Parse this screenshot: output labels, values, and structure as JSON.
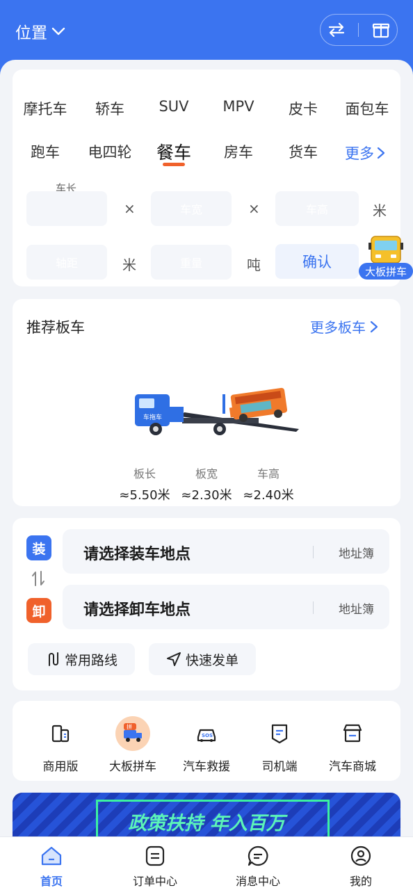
{
  "header": {
    "location": "位置"
  },
  "categories": {
    "row1": [
      "摩托车",
      "轿车",
      "SUV",
      "MPV",
      "皮卡",
      "面包车"
    ],
    "row2": [
      "跑车",
      "电四轮",
      "餐车",
      "房车",
      "货车"
    ],
    "active": "餐车",
    "more": "更多"
  },
  "dimensions": {
    "length_label": "车长",
    "width_placeholder": "车宽",
    "height_placeholder": "车高",
    "wheelbase_placeholder": "轴距",
    "weight_placeholder": "重量",
    "times": "×",
    "unit_m": "米",
    "unit_ton": "吨",
    "confirm": "确认"
  },
  "floating_badge": "大板拼车",
  "recommend": {
    "title": "推荐板车",
    "more": "更多板车",
    "truck_label": "车拖车",
    "specs": [
      {
        "label": "板长",
        "value": "≈5.50米"
      },
      {
        "label": "板宽",
        "value": "≈2.30米"
      },
      {
        "label": "车高",
        "value": "≈2.40米"
      }
    ]
  },
  "address": {
    "load_tag": "装",
    "unload_tag": "卸",
    "load_text": "请选择装车地点",
    "unload_text": "请选择卸车地点",
    "book": "地址簿",
    "routes": "常用路线",
    "quick": "快速发单"
  },
  "services": [
    {
      "name": "商用版",
      "icon": "building-icon"
    },
    {
      "name": "大板拼车",
      "icon": "carpool-truck-icon",
      "badge": "拼"
    },
    {
      "name": "汽车救援",
      "icon": "sos-car-icon",
      "sos": "SOS"
    },
    {
      "name": "司机端",
      "icon": "driver-icon"
    },
    {
      "name": "汽车商城",
      "icon": "store-icon"
    }
  ],
  "banner": {
    "text": "政策扶持 年入百万"
  },
  "tabs": [
    {
      "label": "首页",
      "icon": "home-icon",
      "active": true
    },
    {
      "label": "订单中心",
      "icon": "orders-icon"
    },
    {
      "label": "消息中心",
      "icon": "message-icon"
    },
    {
      "label": "我的",
      "icon": "profile-icon"
    }
  ],
  "colors": {
    "primary": "#3b74f0",
    "accent": "#f0612b",
    "banner_text": "#5cf4b8"
  }
}
